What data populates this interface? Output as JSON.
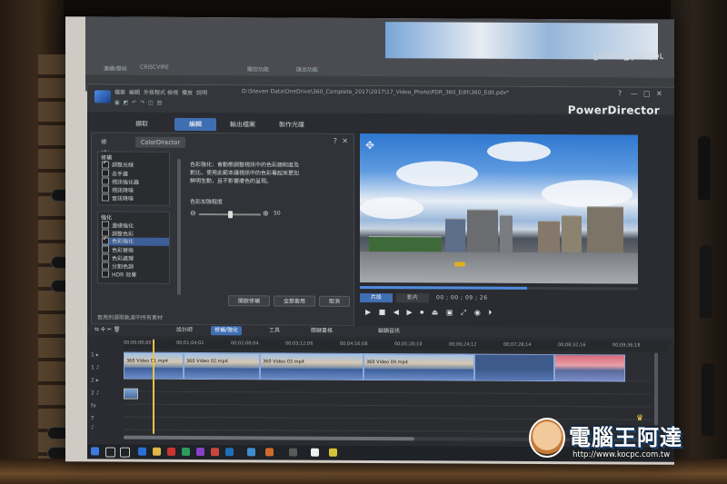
{
  "photo": {
    "ghost_window": {
      "brand": "PowerDirector",
      "tabs": [
        "連續/整段",
        "CRISCVIRE",
        "觸控功能",
        "匯出功能"
      ]
    },
    "app": {
      "brand": "PowerDirector",
      "filepath": "D:\\Steven Data\\OneDrive\\360_Complete_2017\\2017\\17_Video_Photo\\PDR_360_Edit\\360_Edit.pdx*",
      "menu": [
        "檔案",
        "編輯",
        "外掛程式",
        "檢視",
        "播放",
        "說明"
      ],
      "window_controls": [
        "?",
        "—",
        "□",
        "✕"
      ],
      "main_tabs": [
        "擷取",
        "編輯",
        "輸出檔案",
        "製作光碟"
      ],
      "active_tab": "編輯",
      "panel": {
        "tabs": [
          "修補/強化",
          "ColorDirector"
        ],
        "help": "?",
        "close": "✕",
        "group1": {
          "title": "修補",
          "items": [
            "調整光線",
            "去手震",
            "視訊強化器",
            "視訊降噪",
            "音訊降噪"
          ]
        },
        "group2": {
          "title": "強化",
          "items": [
            "邊緣強化",
            "調整色彩",
            "色彩強化",
            "色彩替換",
            "色彩處理",
            "分割色調",
            "HDR 效果"
          ],
          "selected": "色彩強化"
        },
        "description": "色彩強化：會動態調整視訊中的色彩飽和度及對比，使用此範本讓視訊中的色彩看起來更加鮮明生動，且不影響膚色的呈現。",
        "slider_label": "色彩加強程度",
        "slider_value": "50",
        "slider_level": 0.5,
        "buttons": [
          "開啟修補",
          "全部套用",
          "取消"
        ],
        "footer": "套用到選取軌道中所有素材"
      },
      "player": {
        "clip_label": "片段",
        "movie_label": "影片",
        "timecode": "00 ; 00 ; 09 ; 26",
        "progress": 0.6,
        "controls": "▶ ■ ◀ ▶ ⏺ ⏏ ▣ ⤢ ◉ ⏵"
      },
      "timeline": {
        "toolbar": [
          "設計師",
          "修補/強化",
          "工具",
          "關鍵畫格",
          "編輯音訊"
        ],
        "fit_label": "修補/強化",
        "ruler": [
          "00;00;00;00",
          "00;01;04;02",
          "00;02;08;04",
          "00;03;12;06",
          "00;04;16;08",
          "00;05;20;10",
          "00;06;24;12",
          "00;07;28;14",
          "00;08;32;16",
          "00;09;36;18"
        ],
        "track_labels": [
          "1 ▸",
          "1 ♪",
          "2 ▸",
          "2 ♪",
          "fx",
          "T",
          "♪",
          "♪"
        ],
        "clips": [
          {
            "label": "360 Video 01.mp4",
            "style": "sky"
          },
          {
            "label": "360 Video 02.mp4",
            "style": "sky"
          },
          {
            "label": "360 Video 03.mp4",
            "style": "sky"
          },
          {
            "label": "360 Video 04.mp4",
            "style": "sky"
          },
          {
            "label": "",
            "style": "blue"
          },
          {
            "label": "",
            "style": "red"
          }
        ]
      }
    },
    "watermark": {
      "title": "電腦王阿達",
      "url": "http://www.kocpc.com.tw",
      "crown": "♛"
    }
  }
}
